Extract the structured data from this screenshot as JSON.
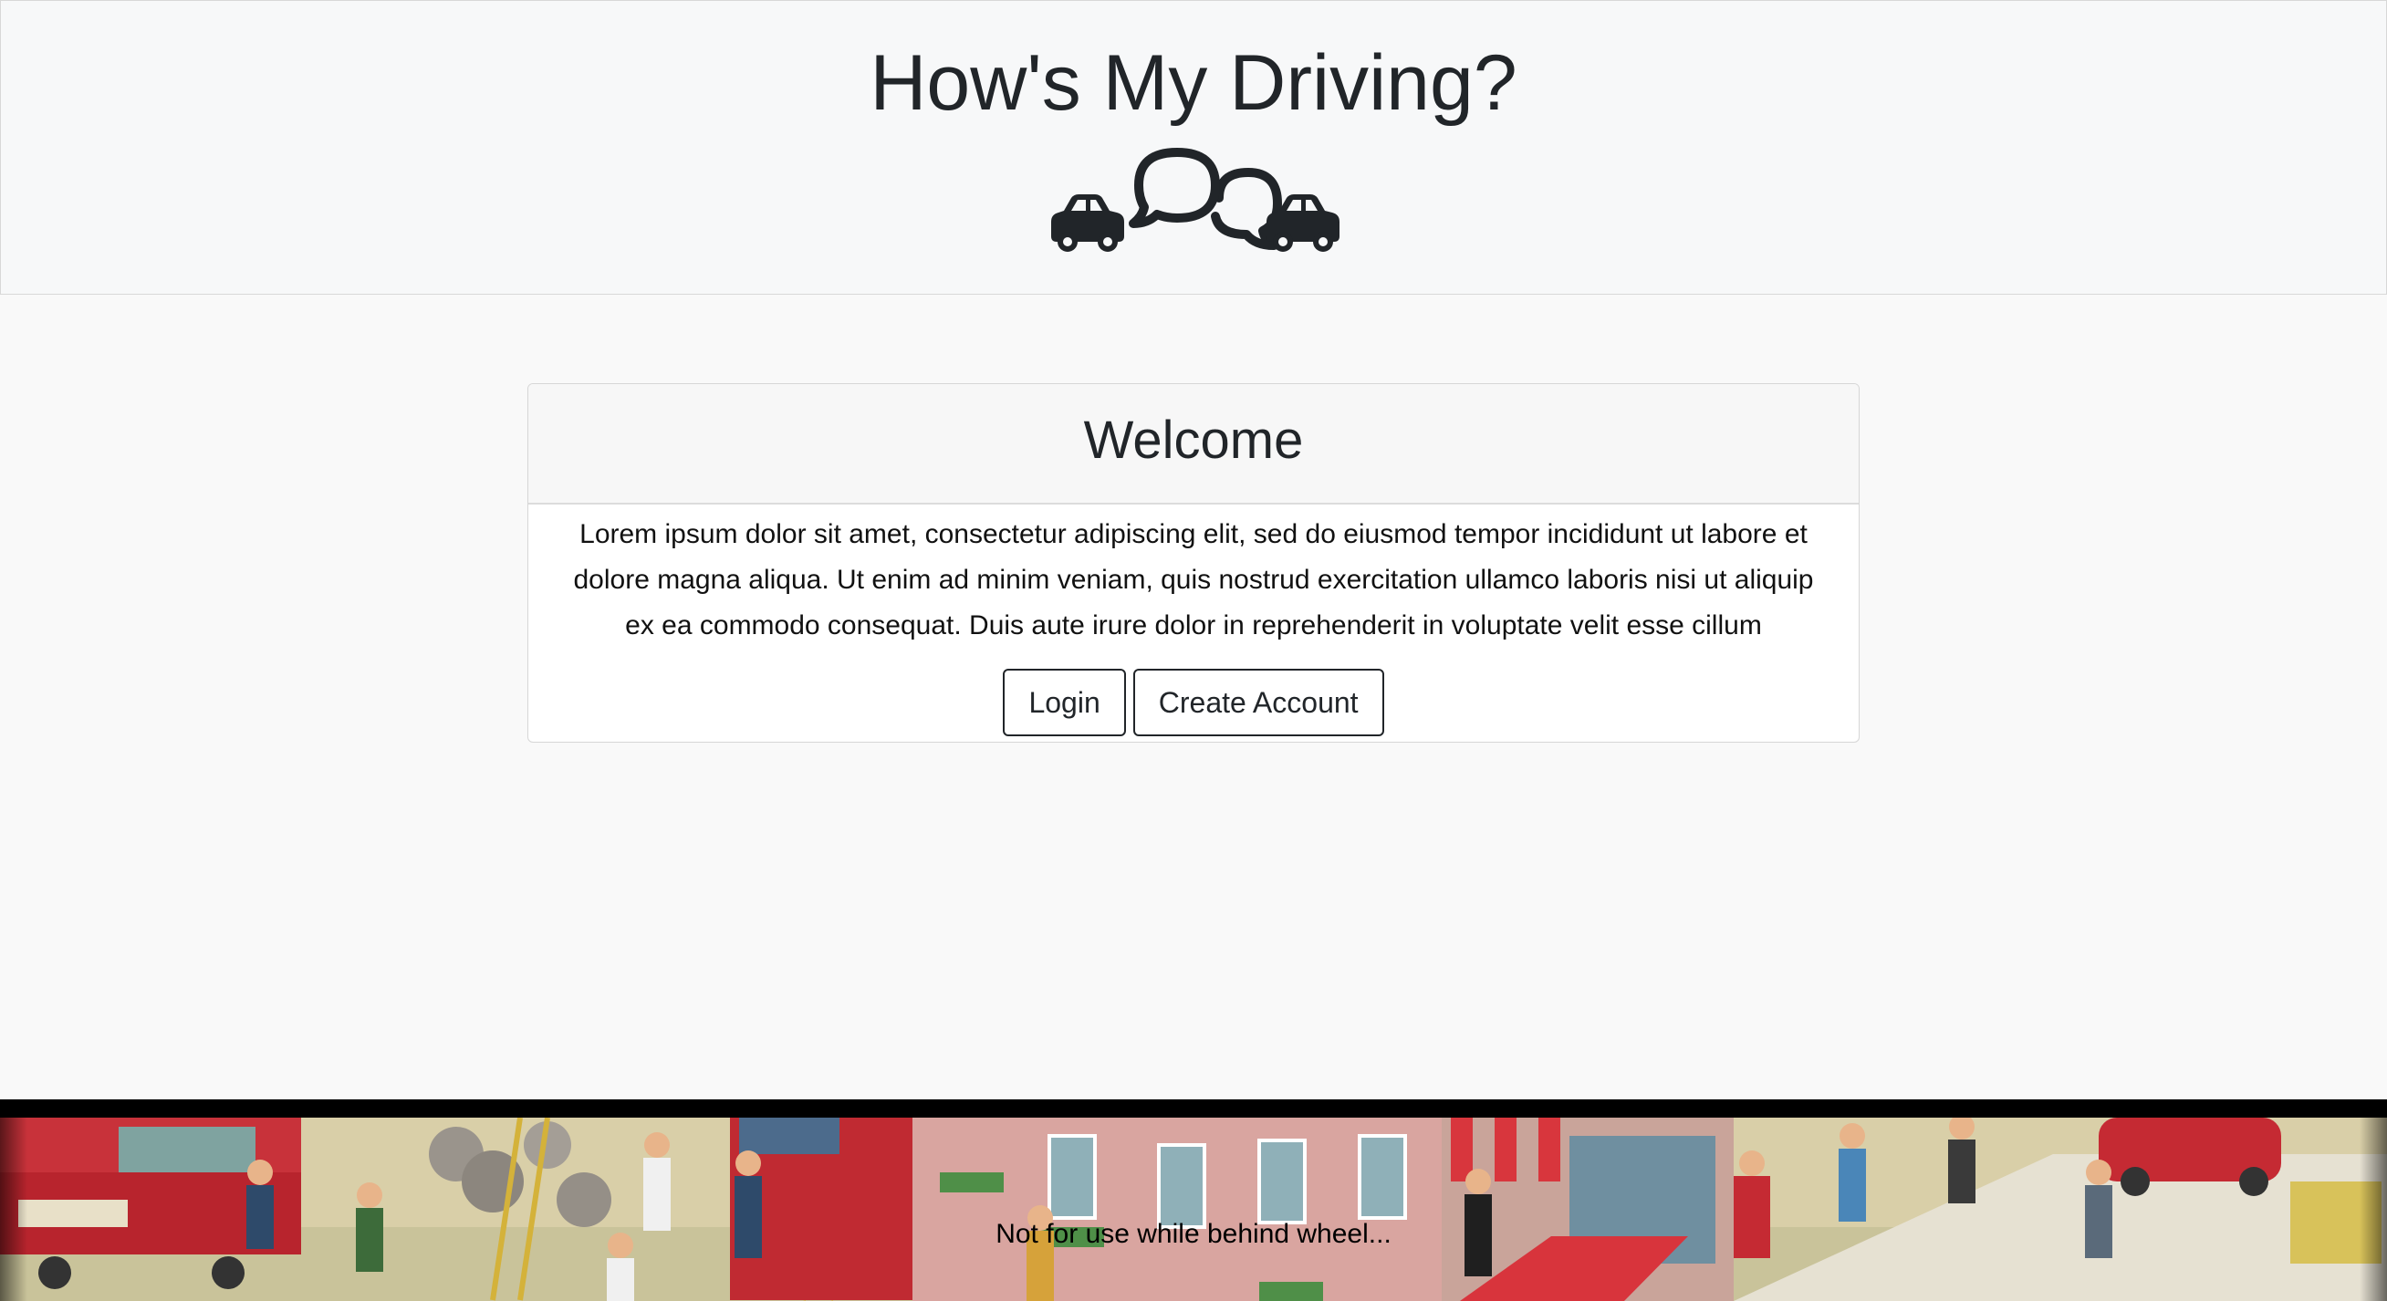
{
  "header": {
    "title": "How's My Driving?",
    "logo_icons": [
      "car-icon",
      "speech-bubbles-icon",
      "car-icon"
    ]
  },
  "welcome": {
    "title": "Welcome",
    "text": "Lorem ipsum dolor sit amet, consectetur adipiscing elit, sed do eiusmod tempor incididunt ut labore et dolore magna aliqua. Ut enim ad minim veniam, quis nostrud exercitation ullamco laboris nisi ut aliquip ex ea commodo consequat. Duis aute irure dolor in reprehenderit in voluptate velit esse cillum",
    "login_label": "Login",
    "create_account_label": "Create Account"
  },
  "footer": {
    "text": "Not for use while behind wheel..."
  },
  "colors": {
    "header_bg": "#f7f8f9",
    "page_bg": "#f9f9f9",
    "text": "#212529",
    "button_border": "#212529"
  }
}
